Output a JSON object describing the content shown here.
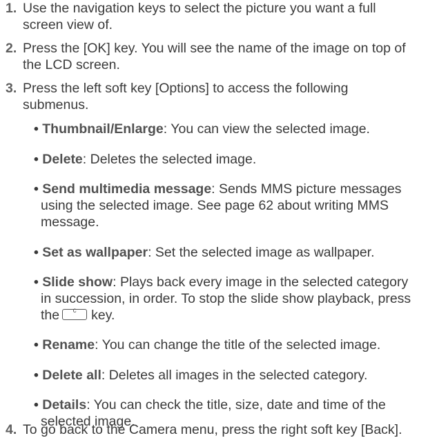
{
  "steps": [
    {
      "number": "1.",
      "lines": [
        "Use the navigation keys to select the picture you want a full",
        "screen view of."
      ]
    },
    {
      "number": "2.",
      "lines": [
        "Press the [OK] key. You will see the name of the image on top of",
        "the LCD screen."
      ]
    },
    {
      "number": "3.",
      "lines": [
        "Press the left soft key [Options] to access the following",
        "submenus."
      ]
    },
    {
      "number": "4.",
      "lines": [
        "To go back to the Camera menu, press the right soft key [Back]."
      ]
    }
  ],
  "submenus": [
    {
      "term": "Thumbnail/Enlarge",
      "desc": [
        ": You can view the selected image."
      ]
    },
    {
      "term": "Delete",
      "desc": [
        ": Deletes the selected image."
      ]
    },
    {
      "term": "Send multimedia message",
      "desc": [
        ": Sends MMS picture messages",
        "using the selected image. See page 62 about writing MMS",
        "message."
      ]
    },
    {
      "term": "Set as wallpaper",
      "desc": [
        ": Set the selected image as wallpaper."
      ]
    },
    {
      "term": "Slide show",
      "desc": [
        ": Plays back every image in the selected category",
        "in succession, in order. To stop the slide show playback, press",
        "the",
        "key."
      ]
    },
    {
      "term": "Rename",
      "desc": [
        ": You can change the title of the selected image."
      ]
    },
    {
      "term": "Delete all",
      "desc": [
        ": Deletes all images in the selected category."
      ]
    },
    {
      "term": "Details",
      "desc": [
        ": You can check the title, size, date and time of the",
        "selected image."
      ]
    }
  ],
  "bullet": "•",
  "clear_key_label": "c"
}
